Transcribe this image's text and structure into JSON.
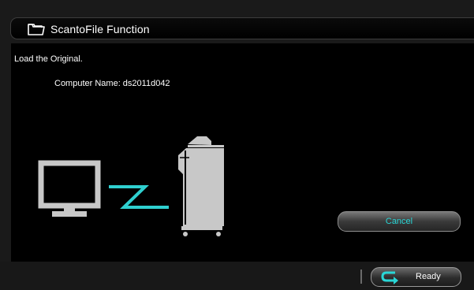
{
  "header": {
    "title": "ScantoFile Function",
    "icon": "folder-icon"
  },
  "main": {
    "message": "Load the Original.",
    "computer_name_line": "Computer Name: ds2011d042",
    "cancel_label": "Cancel"
  },
  "footer": {
    "ready_label": "Ready",
    "ready_icon": "return-arrow-icon"
  },
  "colors": {
    "accent": "#29d6d6",
    "background": "#000000",
    "illustration": "#c8c8c8"
  }
}
